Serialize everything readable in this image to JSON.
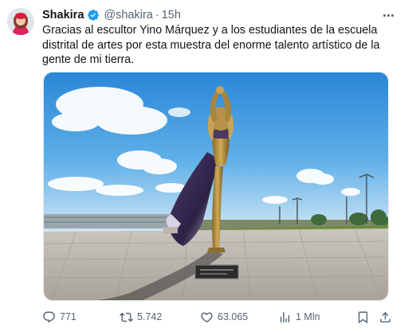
{
  "tweet": {
    "author_name": "Shakira",
    "handle": "@shakira",
    "separator": "·",
    "time": "15h",
    "text": "Gracias al escultor Yino Márquez y a los estudiantes de la escuela distrital de artes por esta muestra del enorme talento artístico de la gente de mi tierra."
  },
  "actions": {
    "replies": "771",
    "reposts": "5.742",
    "likes": "63.065",
    "views": "1 Mln"
  },
  "colors": {
    "verified": "#1d9bf0",
    "muted": "#536471",
    "text": "#0f1419"
  },
  "icons": [
    "verified-badge-icon",
    "more-icon",
    "reply-icon",
    "repost-icon",
    "like-icon",
    "views-icon",
    "bookmark-icon",
    "share-icon"
  ]
}
